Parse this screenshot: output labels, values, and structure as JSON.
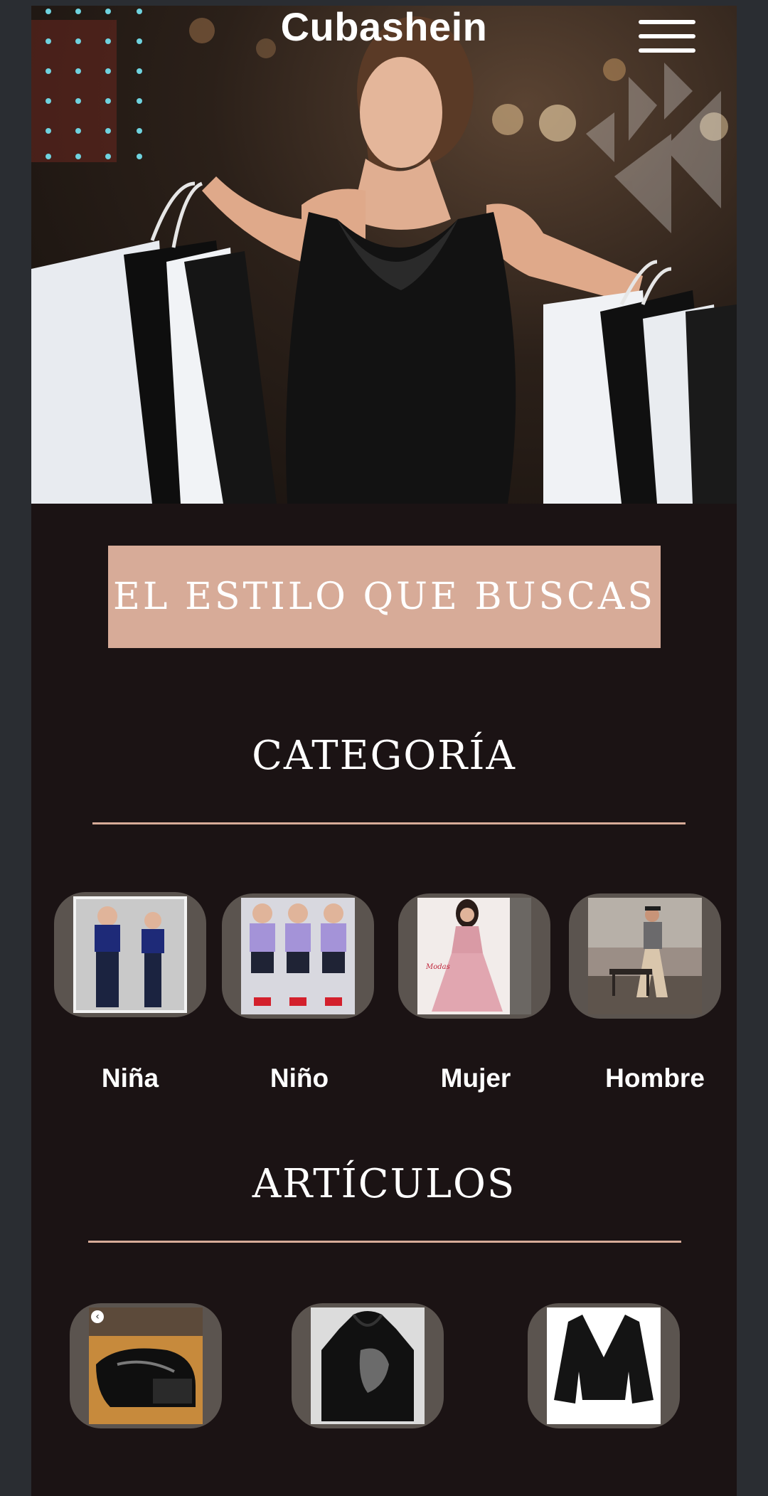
{
  "header": {
    "brand": "Cubashein"
  },
  "banner": {
    "text": "EL ESTILO QUE BUSCAS"
  },
  "categories": {
    "title": "CATEGORÍA",
    "items": [
      {
        "label": "Niña"
      },
      {
        "label": "Niño"
      },
      {
        "label": "Mujer"
      },
      {
        "label": "Hombre"
      }
    ]
  },
  "articles": {
    "title": "ARTÍCULOS"
  },
  "colors": {
    "accent": "#d7ab98",
    "background": "#1b1314",
    "thumb_bg": "#5b544f"
  },
  "icons": {
    "menu": "hamburger-icon"
  }
}
